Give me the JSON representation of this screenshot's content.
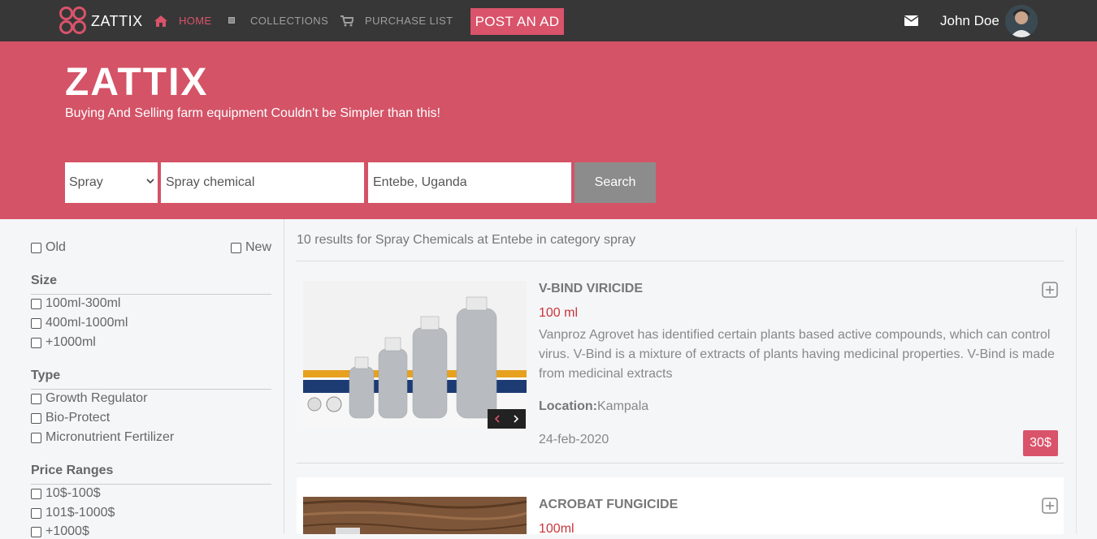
{
  "nav": {
    "brand": "ZATTIX",
    "items": [
      {
        "label": "HOME",
        "icon": "home-icon",
        "active": true
      },
      {
        "label": "COLLECTIONS",
        "icon": "square-icon",
        "active": false
      },
      {
        "label": "PURCHASE LIST",
        "icon": "cart-icon",
        "active": false
      }
    ],
    "post_ad": "POST AN AD",
    "user_name": "John Doe"
  },
  "hero": {
    "title": "ZATTIX",
    "subtitle": "Buying And Selling farm equipment Couldn't be Simpler than this!"
  },
  "search": {
    "category": "Spray",
    "query": "Spray chemical",
    "location": "Entebe, Uganda",
    "button": "Search"
  },
  "filters": {
    "condition": [
      "Old",
      "New"
    ],
    "sections": [
      {
        "title": "Size",
        "options": [
          "100ml-300ml",
          "400ml-1000ml",
          "+1000ml"
        ]
      },
      {
        "title": "Type",
        "options": [
          "Growth Regulator",
          "Bio-Protect",
          "Micronutrient Fertilizer"
        ]
      },
      {
        "title": "Price Ranges",
        "options": [
          "10$-100$",
          "101$-1000$",
          "+1000$"
        ]
      }
    ]
  },
  "results": {
    "summary": "10 results for Spray Chemicals at Entebe in category spray",
    "products": [
      {
        "title": "V-BIND VIRICIDE",
        "size": "100 ml",
        "description": "Vanproz Agrovet has identified certain plants based active compounds, which can control virus. V-Bind is a mixture of extracts of plants having medicinal properties. V-Bind is made from medicinal extracts",
        "location_label": "Location:",
        "location": "Kampala",
        "date": "24-feb-2020",
        "price": "30$"
      },
      {
        "title": "ACROBAT FUNGICIDE",
        "size": "100ml"
      }
    ]
  },
  "colors": {
    "accent": "#d9536a",
    "nav_bg": "#373737",
    "hero_bg": "#d45367"
  }
}
